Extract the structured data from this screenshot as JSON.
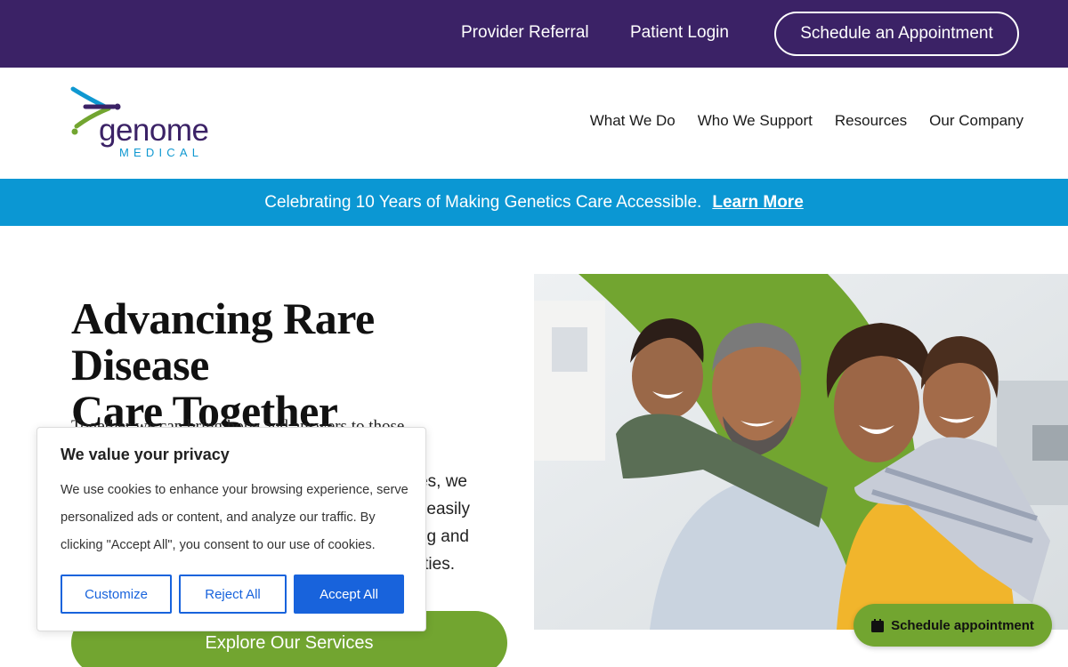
{
  "topbar": {
    "provider_referral": "Provider Referral",
    "patient_login": "Patient Login",
    "schedule_cta": "Schedule an Appointment",
    "background": "#3b2266"
  },
  "brand": {
    "name": "genome",
    "sub": "MEDICAL",
    "colors": {
      "purple": "#3b2266",
      "blue": "#0f98d1",
      "green": "#72a530"
    }
  },
  "nav": {
    "items": [
      {
        "label": "What We Do"
      },
      {
        "label": "Who We Support"
      },
      {
        "label": "Resources"
      },
      {
        "label": "Our Company"
      }
    ]
  },
  "banner": {
    "text": "Celebrating 10 Years of Making Genetics Care Accessible.",
    "link": "Learn More",
    "background": "#0b97d3"
  },
  "hero": {
    "title_line1": "Advancing Rare Disease",
    "title_line2": "Care Together",
    "body_line1": "Together we can bring hope and answers to those",
    "body_line3_end": "es, we",
    "body_line4_end": "easily",
    "body_line5_end": "g and",
    "body_line6_end": "ties.",
    "cta": "Explore Our Services",
    "image_icon": "family-photo"
  },
  "cookie": {
    "title": "We value your privacy",
    "text": "We use cookies to enhance your browsing experience, serve personalized ads or content, and analyze our traffic. By clicking \"Accept All\", you consent to our use of cookies.",
    "customize": "Customize",
    "reject": "Reject All",
    "accept": "Accept All",
    "accent": "#1863dc"
  },
  "floating": {
    "schedule": "Schedule appointment",
    "icon": "calendar-icon"
  }
}
